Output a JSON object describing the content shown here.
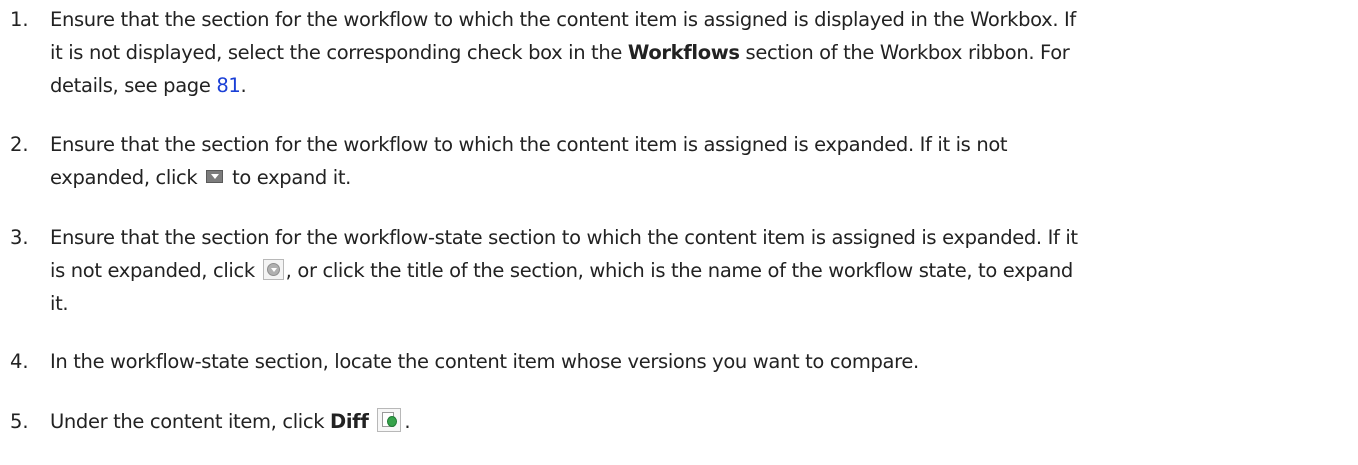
{
  "steps": [
    {
      "number": "1.",
      "line1": "Ensure that the section for the workflow to which the content item is assigned is displayed in the Workbox. If",
      "line2_a": "it is not displayed, select the corresponding check box in the ",
      "line2_bold": "Workflows",
      "line2_b": " section of the Workbox ribbon. For",
      "line3_a": "details, see page ",
      "line3_link": "81",
      "line3_b": "."
    },
    {
      "number": "2.",
      "line1": "Ensure that the section for the workflow to which the content item is assigned is expanded. If it is not",
      "line2_a": "expanded, click",
      "line2_b": "to expand it.",
      "icon": "expand-arrow-icon"
    },
    {
      "number": "3.",
      "line1": "Ensure that the section for the workflow-state section to which the content item is assigned is expanded. If it",
      "line2_a": "is not expanded, click",
      "line2_b": ", or click the title of the section, which is the name of the workflow state, to expand",
      "line3": "it.",
      "icon": "circle-expand-icon"
    },
    {
      "number": "4.",
      "line1": "In the workflow-state section, locate the content item whose versions you want to compare."
    },
    {
      "number": "5.",
      "line1_a": "Under the content item, click ",
      "line1_bold": "Diff",
      "line1_b": ".",
      "icon": "diff-icon"
    }
  ]
}
